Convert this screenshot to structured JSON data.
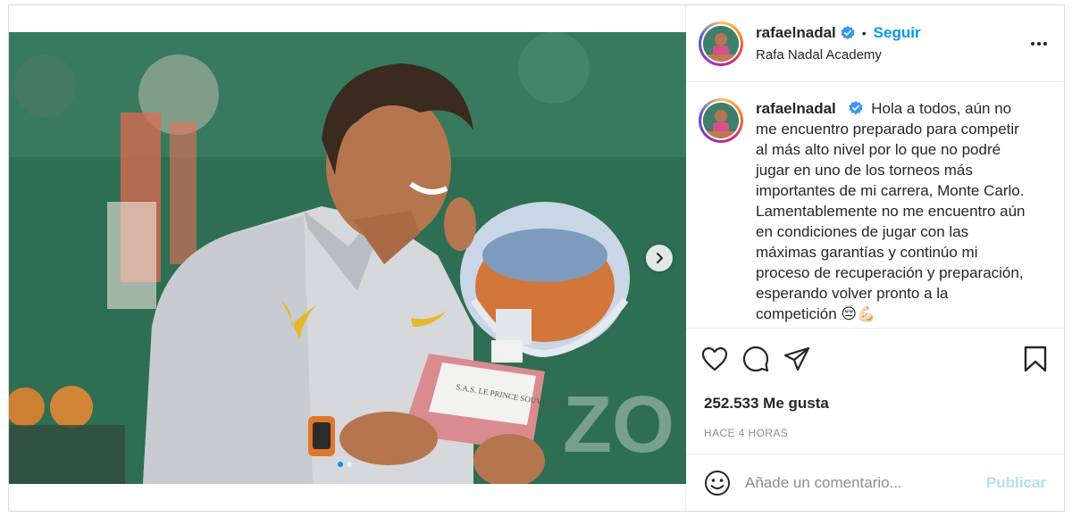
{
  "post": {
    "image_alt": "Rafael Nadal con el trofeo de Monte Carlo",
    "carousel": {
      "total": 2,
      "active": 1
    }
  },
  "header": {
    "username": "rafaelnadal",
    "separator": "•",
    "follow_label": "Seguir",
    "location": "Rafa Nadal Academy"
  },
  "caption": {
    "username": "rafaelnadal",
    "text": "Hola a todos, aún no me encuentro preparado para competir al más alto nivel por lo que no podré jugar en uno de los torneos más importantes de mi carrera, Monte Carlo. Lamentablemente no me encuentro aún en condiciones de jugar con las máximas garantías y continúo mi proceso de recuperación y preparación, esperando volver pronto a la competición 😔💪🏻"
  },
  "engagement": {
    "likes": "252.533 Me gusta",
    "timestamp": "HACE 4 HORAS"
  },
  "comment": {
    "placeholder": "Añade un comentario...",
    "publish_label": "Publicar"
  },
  "colors": {
    "accent": "#0095f6",
    "publish_disabled": "#b2dffc",
    "muted": "#8e8e8e"
  }
}
